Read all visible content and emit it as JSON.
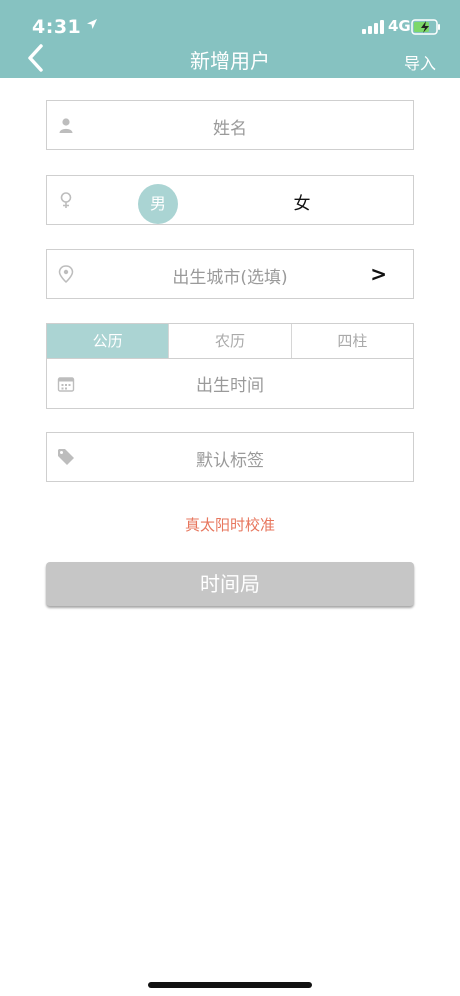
{
  "status_bar": {
    "time": "4:31",
    "network": "4G"
  },
  "nav": {
    "title": "新增用户",
    "right_action": "导入"
  },
  "form": {
    "name_placeholder": "姓名",
    "gender": {
      "male_label": "男",
      "female_label": "女",
      "selected": "男"
    },
    "city_placeholder": "出生城市(选填)",
    "city_arrow": ">",
    "calendar_tabs": [
      "公历",
      "农历",
      "四柱"
    ],
    "calendar_active": "公历",
    "birth_time_placeholder": "出生时间",
    "tag_placeholder": "默认标签",
    "solar_time_link": "真太阳时校准",
    "submit_label": "时间局"
  },
  "colors": {
    "header_bg": "#86c2c1",
    "accent": "#abd4d3",
    "link": "#e7765d",
    "button_disabled": "#c6c6c6"
  }
}
